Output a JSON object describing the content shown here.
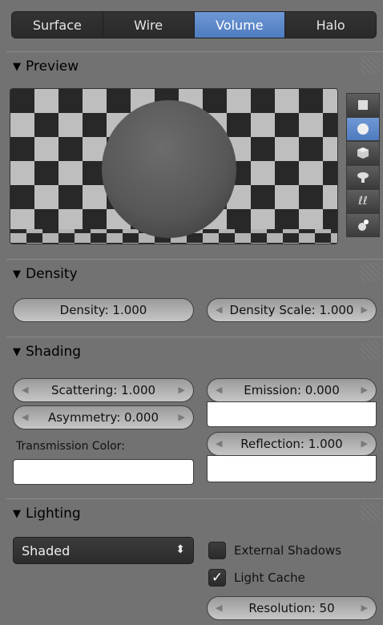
{
  "tabs": {
    "surface": "Surface",
    "wire": "Wire",
    "volume": "Volume",
    "halo": "Halo",
    "active": "Volume"
  },
  "preview": {
    "title": "Preview",
    "shape_buttons": [
      "square-icon",
      "sphere-icon",
      "cube-icon",
      "monkey-icon",
      "hair-icon",
      "sphere-lamp-icon"
    ],
    "active_shape": "sphere-icon"
  },
  "density": {
    "title": "Density",
    "density_label": "Density: 1.000",
    "density_scale_label": "Density Scale: 1.000"
  },
  "shading": {
    "title": "Shading",
    "scattering_label": "Scattering: 1.000",
    "asymmetry_label": "Asymmetry: 0.000",
    "emission_label": "Emission: 0.000",
    "reflection_label": "Reflection: 1.000",
    "transmission_color_label": "Transmission Color:"
  },
  "lighting": {
    "title": "Lighting",
    "mode": "Shaded",
    "external_shadows_label": "External Shadows",
    "external_shadows_checked": false,
    "light_cache_label": "Light Cache",
    "light_cache_checked": true,
    "resolution_label": "Resolution: 50"
  },
  "colors": {
    "active_blue": "#5884c8",
    "panel_bg": "#727272"
  }
}
